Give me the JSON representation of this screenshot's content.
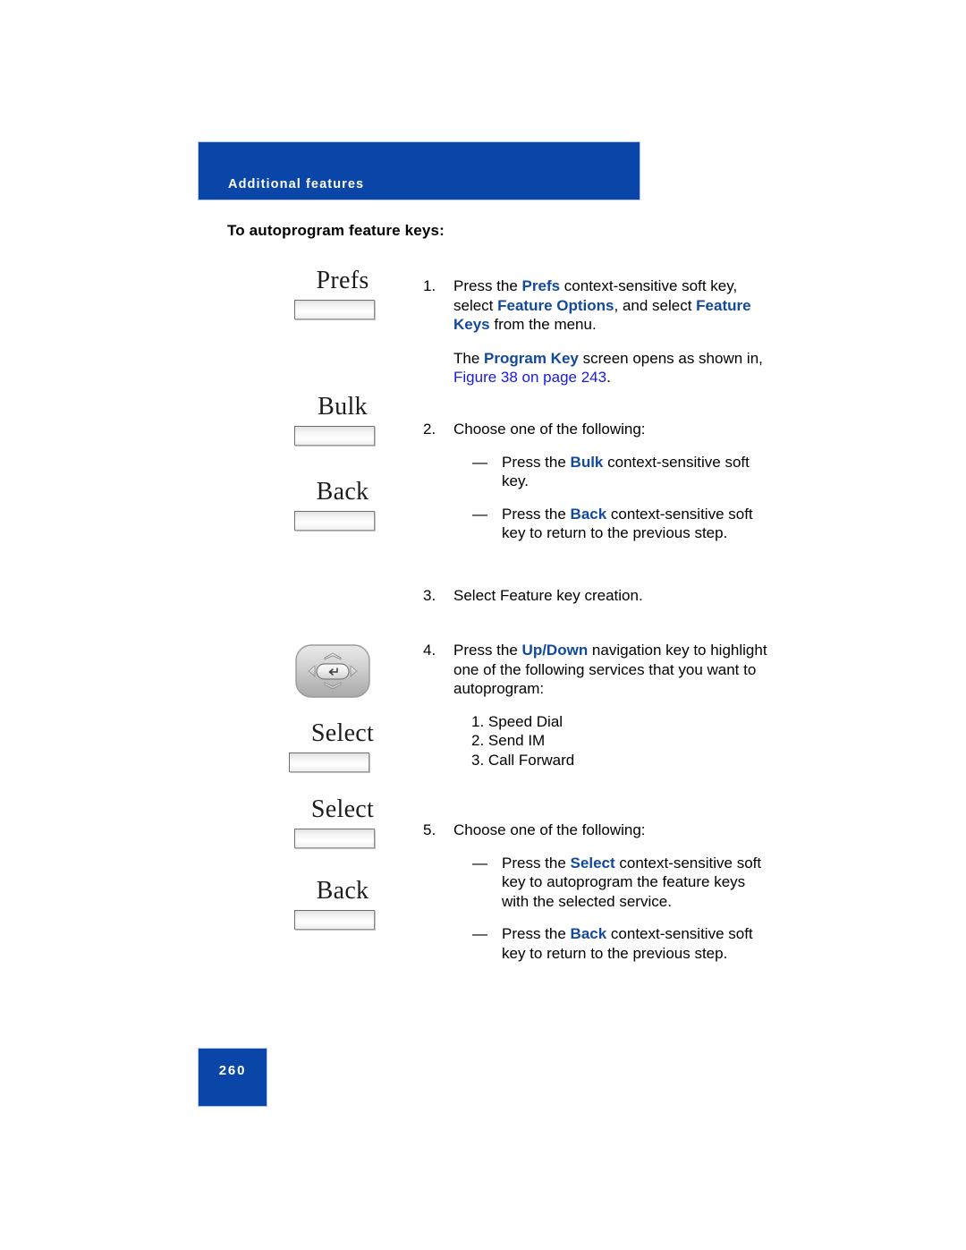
{
  "header": {
    "band_label": "Additional features",
    "band_color": "#0a46a8"
  },
  "page_heading": "To autoprogram feature keys:",
  "footer": {
    "page_number": "260",
    "block_color": "#0a46a8"
  },
  "colors": {
    "keyword_blue": "#13499c",
    "xref_blue": "#1a1ae0",
    "band_blue": "#0a46a8"
  },
  "softkeys": [
    {
      "label": "Prefs",
      "name": "softkey-prefs"
    },
    {
      "label": "Bulk",
      "name": "softkey-bulk"
    },
    {
      "label": "Back",
      "name": "softkey-back-1"
    },
    {
      "label": "Select",
      "name": "softkey-select-1"
    },
    {
      "label": "Select",
      "name": "softkey-select-2"
    },
    {
      "label": "Back",
      "name": "softkey-back-2"
    }
  ],
  "navigation_key": {
    "icon": "navigation-cluster-icon",
    "directions": [
      "up",
      "down",
      "left",
      "right"
    ],
    "center": "enter"
  },
  "steps": [
    {
      "number": "1.",
      "paragraphs": [
        [
          {
            "t": "Press the "
          },
          {
            "t": "Prefs",
            "s": "kw"
          },
          {
            "t": " context-sensitive soft key, select "
          },
          {
            "t": "Feature Options",
            "s": "kw"
          },
          {
            "t": ", and select "
          },
          {
            "t": "Feature Keys",
            "s": "kw"
          },
          {
            "t": " from the menu."
          }
        ],
        [
          {
            "t": "The "
          },
          {
            "t": "Program Key",
            "s": "kw"
          },
          {
            "t": " screen opens as shown in, "
          },
          {
            "t": "Figure 38 on page 243",
            "s": "xref"
          },
          {
            "t": "."
          }
        ]
      ]
    },
    {
      "number": "2.",
      "paragraphs": [
        [
          {
            "t": "Choose one of the following:"
          }
        ]
      ],
      "dashes": [
        [
          {
            "t": "Press the "
          },
          {
            "t": "Bulk",
            "s": "kw"
          },
          {
            "t": " context-sensitive soft key."
          }
        ],
        [
          {
            "t": "Press the "
          },
          {
            "t": "Back",
            "s": "kw"
          },
          {
            "t": " context-sensitive soft key to return to the previous step."
          }
        ]
      ]
    },
    {
      "number": "3.",
      "paragraphs": [
        [
          {
            "t": "Select Feature key creation."
          }
        ]
      ]
    },
    {
      "number": "4.",
      "paragraphs": [
        [
          {
            "t": "Press the "
          },
          {
            "t": "Up/Down",
            "s": "kw"
          },
          {
            "t": " navigation key to highlight one of the following services that you want to autoprogram:"
          }
        ]
      ],
      "sublist": [
        "1. Speed Dial",
        "2. Send IM",
        "3. Call Forward"
      ]
    },
    {
      "number": "5.",
      "paragraphs": [
        [
          {
            "t": "Choose one of the following:"
          }
        ]
      ],
      "dashes": [
        [
          {
            "t": "Press the "
          },
          {
            "t": "Select",
            "s": "kw"
          },
          {
            "t": " context-sensitive soft key to autoprogram the feature keys with the selected service."
          }
        ],
        [
          {
            "t": "Press the "
          },
          {
            "t": "Back",
            "s": "kw"
          },
          {
            "t": " context-sensitive soft key to return to the previous step."
          }
        ]
      ]
    }
  ]
}
